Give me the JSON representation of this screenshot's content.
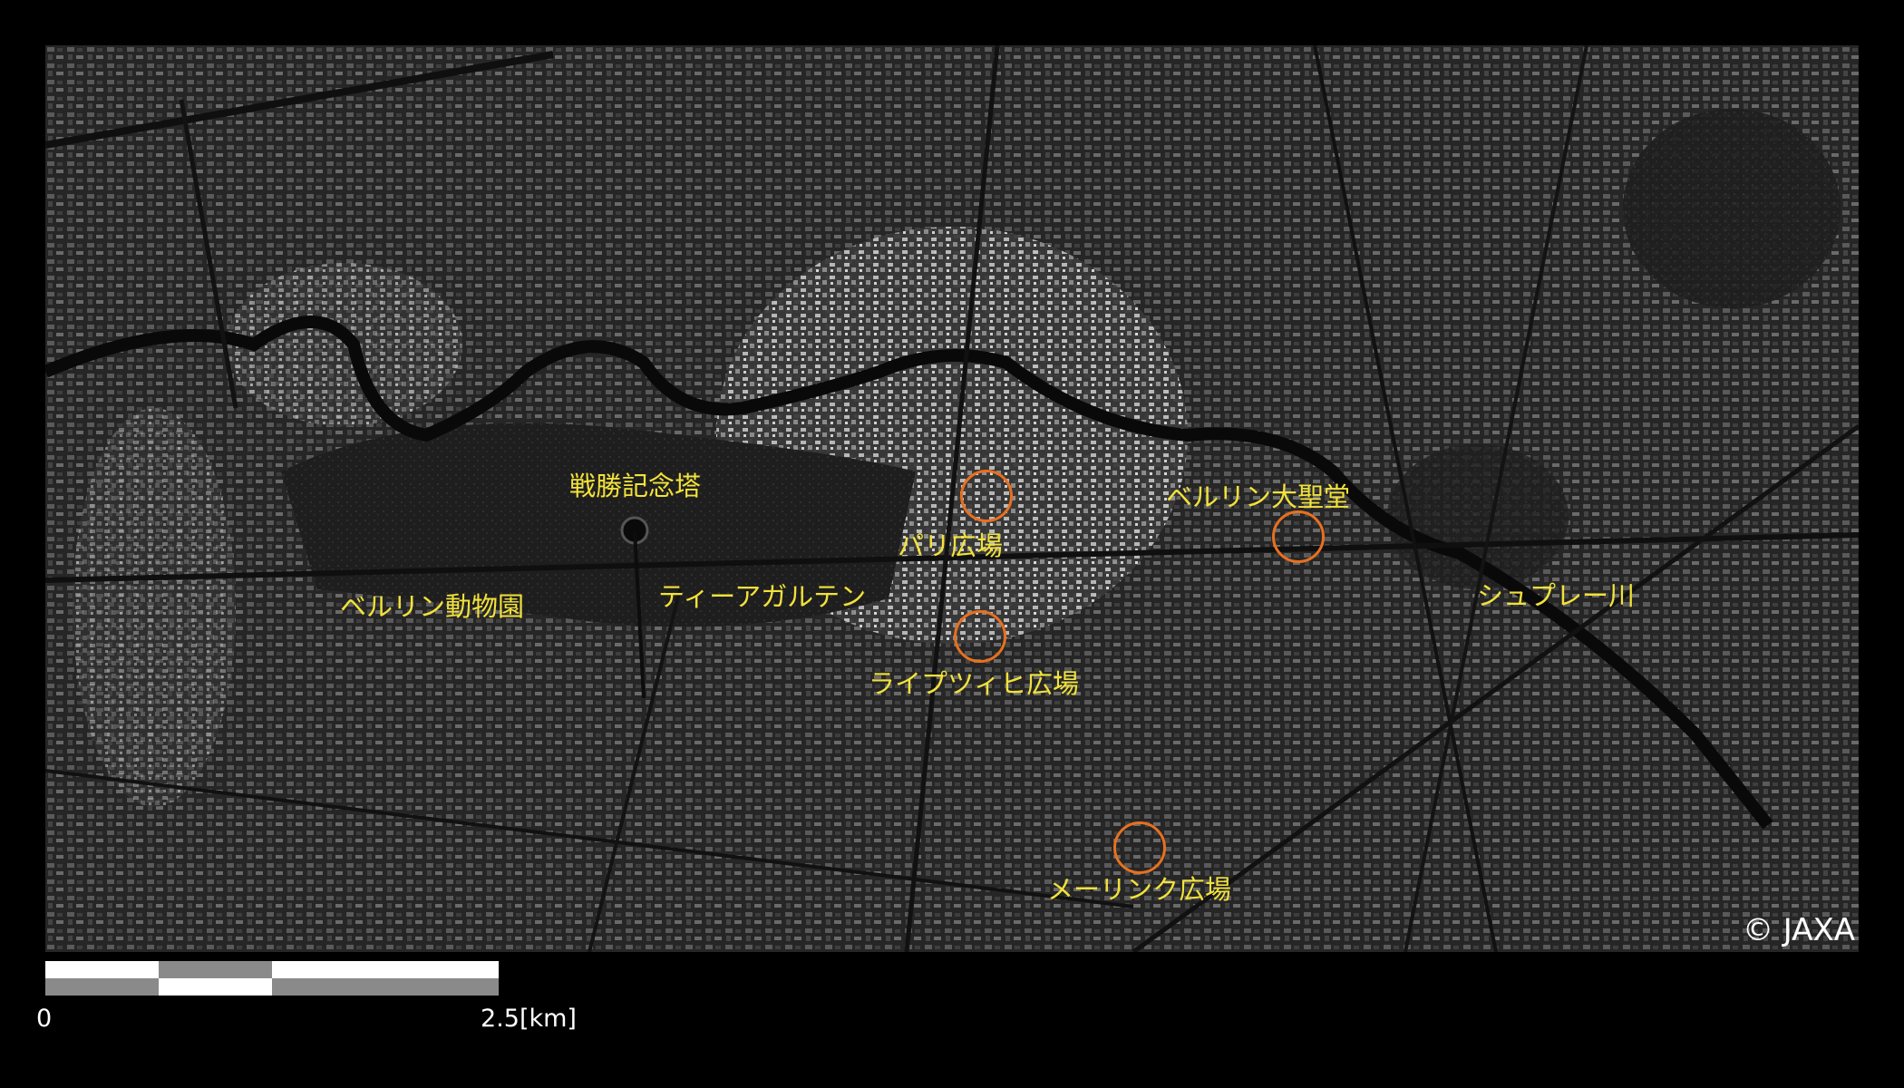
{
  "map": {
    "type": "satellite radar image",
    "colors": {
      "background": "#000000",
      "label": "#f2e23a",
      "marker": "#e8701f"
    },
    "credit": "© JAXA",
    "labels": {
      "victory_column": "戦勝記念塔",
      "paris_square": "パリ広場",
      "berlin_cathedral": "ベルリン大聖堂",
      "berlin_zoo": "ベルリン動物園",
      "tiergarten": "ティーアガルテン",
      "spree_river": "シュプレー川",
      "leipziger_platz": "ライプツィヒ広場",
      "mehringplatz": "メーリンク広場"
    },
    "markers": [
      "paris-square",
      "berlin-cathedral",
      "leipziger-platz",
      "mehringplatz"
    ]
  },
  "scale": {
    "start": "0",
    "end": "2.5[km]"
  }
}
